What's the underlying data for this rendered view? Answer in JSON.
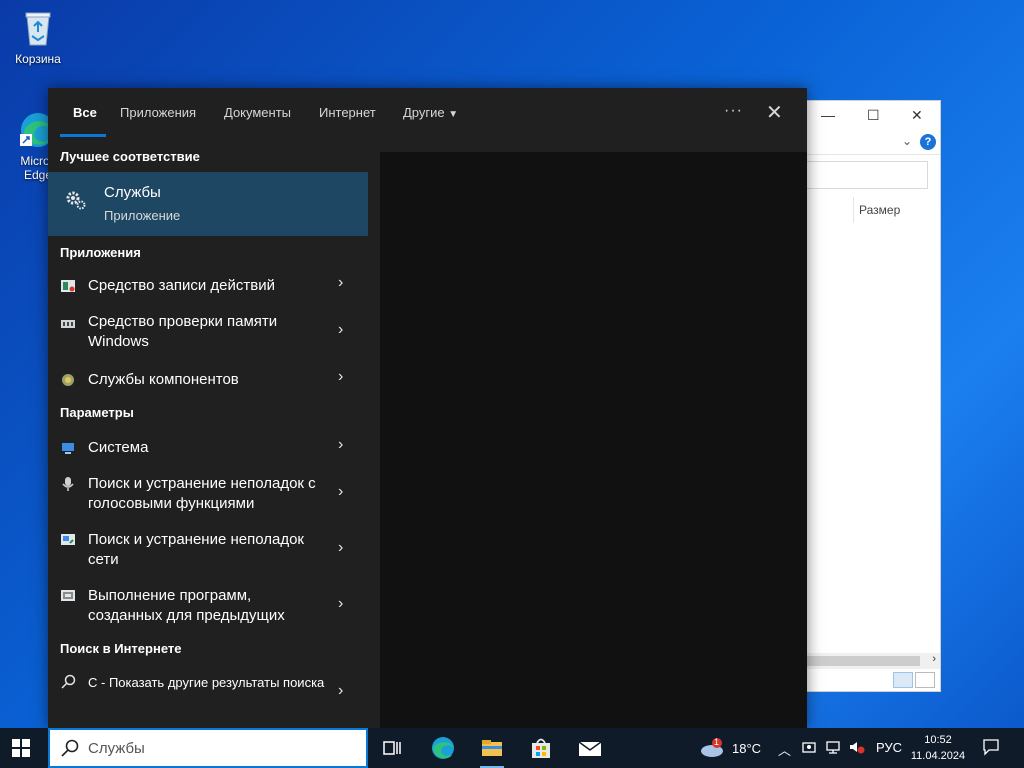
{
  "desktop": {
    "icons": [
      {
        "label": "Корзина"
      },
      {
        "label": "Micros\nEdge"
      }
    ]
  },
  "explorer": {
    "column_size_label": "Размер",
    "help_glyph": "?"
  },
  "search_panel": {
    "tabs": [
      {
        "label": "Все",
        "active": true
      },
      {
        "label": "Приложения"
      },
      {
        "label": "Документы"
      },
      {
        "label": "Интернет"
      },
      {
        "label": "Другие"
      }
    ],
    "more_options": "···",
    "close_glyph": "✕",
    "best_match_title": "Лучшее соответствие",
    "best_match": {
      "name": "Службы",
      "type": "Приложение",
      "icon": "gear-icon"
    },
    "apps_title": "Приложения",
    "apps": [
      {
        "label": "Средство записи действий",
        "icon": "steps-recorder-icon"
      },
      {
        "label": "Средство проверки памяти Windows",
        "icon": "memory-diagnostic-icon"
      },
      {
        "label": "Службы компонентов",
        "icon": "component-services-icon"
      }
    ],
    "settings_title": "Параметры",
    "settings": [
      {
        "label": "Система",
        "icon": "system-icon"
      },
      {
        "label": "Поиск и устранение неполадок с голосовыми функциями",
        "icon": "microphone-icon"
      },
      {
        "label": "Поиск и устранение неполадок сети",
        "icon": "network-troubleshoot-icon"
      },
      {
        "label": "Выполнение программ, созданных для предыдущих",
        "icon": "compatibility-icon"
      }
    ],
    "web_title": "Поиск в Интернете",
    "web": [
      {
        "label": "С - Показать другие результаты поиска",
        "icon": "search-icon"
      }
    ],
    "arrow_glyph": "›"
  },
  "taskbar": {
    "search_value": "Службы",
    "weather_temp": "18°C",
    "weather_badge": "1",
    "language": "РУС",
    "time": "10:52",
    "date": "11.04.2024"
  }
}
